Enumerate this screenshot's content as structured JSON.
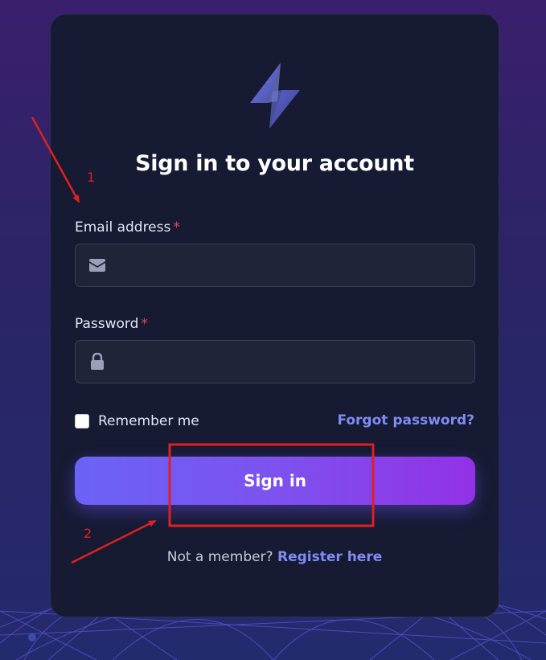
{
  "colors": {
    "background": "#2a2566",
    "card": "#161a32",
    "accent": "#7f8cf3",
    "button_start": "#6a63f5",
    "button_end": "#9231e6",
    "required": "#e5484d",
    "annotation": "#e02020"
  },
  "login": {
    "logo_icon": "bolt-logo-icon",
    "title": "Sign in to your account",
    "email": {
      "label": "Email address",
      "required_mark": "*",
      "icon": "envelope-icon",
      "value": "",
      "placeholder": ""
    },
    "password": {
      "label": "Password",
      "required_mark": "*",
      "icon": "lock-icon",
      "value": "",
      "placeholder": ""
    },
    "remember_label": "Remember me",
    "remember_checked": false,
    "forgot_label": "Forgot password?",
    "signin_label": "Sign in",
    "footer_text": "Not a member?",
    "register_label": "Register here"
  },
  "annotations": {
    "marker_1": "1",
    "marker_2": "2"
  }
}
